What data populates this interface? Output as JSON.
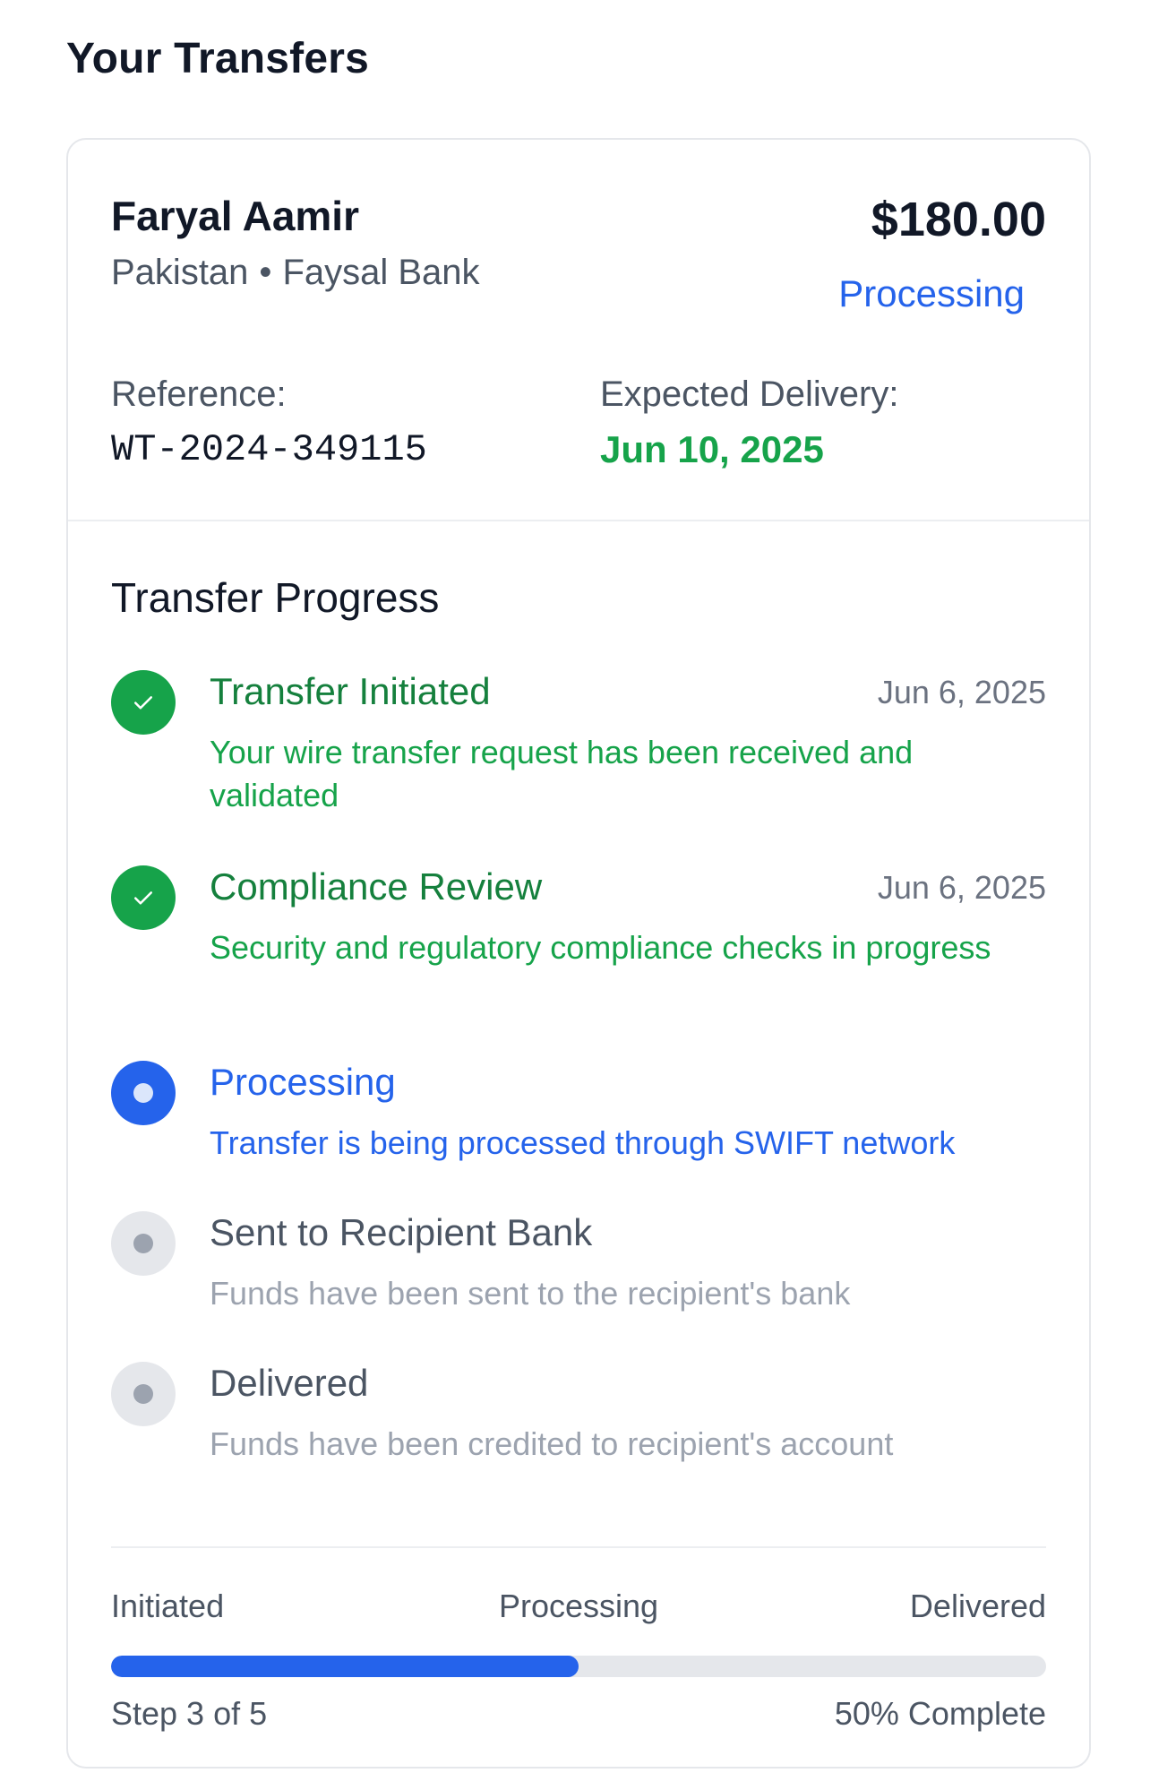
{
  "page": {
    "title": "Your Transfers"
  },
  "transfer": {
    "recipient_name": "Faryal Aamir",
    "country": "Pakistan",
    "separator": "•",
    "bank": "Faysal Bank",
    "amount": "$180.00",
    "status": "Processing",
    "reference_label": "Reference:",
    "reference_value": "WT-2024-349115",
    "expected_label": "Expected Delivery:",
    "expected_value": "Jun 10, 2025"
  },
  "progress": {
    "title": "Transfer Progress",
    "steps": [
      {
        "title": "Transfer Initiated",
        "date": "Jun 6, 2025",
        "desc": "Your wire transfer request has been received and validated",
        "state": "done"
      },
      {
        "title": "Compliance Review",
        "date": "Jun 6, 2025",
        "desc": "Security and regulatory compliance checks in progress",
        "state": "done"
      },
      {
        "title": "Processing",
        "date": "",
        "desc": "Transfer is being processed through SWIFT network",
        "state": "current"
      },
      {
        "title": "Sent to Recipient Bank",
        "date": "",
        "desc": "Funds have been sent to the recipient's bank",
        "state": "pending"
      },
      {
        "title": "Delivered",
        "date": "",
        "desc": "Funds have been credited to recipient's account",
        "state": "pending"
      }
    ],
    "bar_labels": {
      "start": "Initiated",
      "middle": "Processing",
      "end": "Delivered"
    },
    "percent_value": 50,
    "step_text": "Step 3 of 5",
    "percent_text": "50% Complete"
  },
  "colors": {
    "done": "#16a34a",
    "current": "#2563eb",
    "pending": "#e5e7eb"
  },
  "icons": {
    "done": "check-icon",
    "current": "dot-icon",
    "pending": "dot-icon"
  }
}
